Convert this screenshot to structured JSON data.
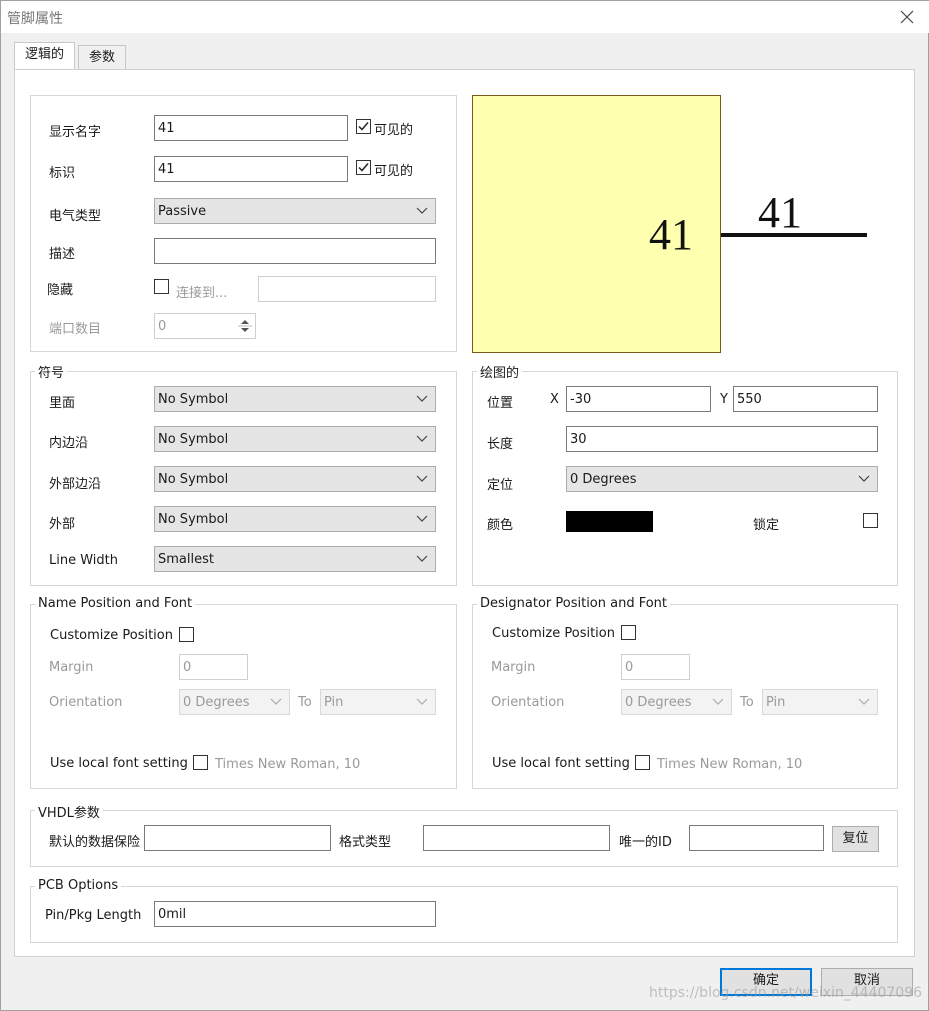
{
  "window": {
    "title": "管脚属性"
  },
  "tabs": [
    "逻辑的",
    "参数"
  ],
  "logical": {
    "display_name": {
      "label": "显示名字",
      "value": "41",
      "visible_label": "可见的",
      "visible_checked": true
    },
    "designator": {
      "label": "标识",
      "value": "41",
      "visible_label": "可见的",
      "visible_checked": true
    },
    "electrical_type": {
      "label": "电气类型",
      "value": "Passive"
    },
    "description": {
      "label": "描述",
      "value": ""
    },
    "hidden": {
      "label": "隐藏",
      "checked": false,
      "connect_label": "连接到...",
      "connect_value": ""
    },
    "port_count": {
      "label": "端口数目",
      "value": "0"
    }
  },
  "preview": {
    "name_text": "41",
    "designator_text": "41",
    "fill_color": "#ffffb0",
    "border_color": "#7a5a1a"
  },
  "symbols": {
    "title": "符号",
    "inside": {
      "label": "里面",
      "value": "No Symbol"
    },
    "inside_edge": {
      "label": "内边沿",
      "value": "No Symbol"
    },
    "outside_edge": {
      "label": "外部边沿",
      "value": "No Symbol"
    },
    "outside": {
      "label": "外部",
      "value": "No Symbol"
    },
    "line_width": {
      "label": "Line Width",
      "value": "Smallest"
    }
  },
  "graphical": {
    "title": "绘图的",
    "location": {
      "label": "位置",
      "x_label": "X",
      "x_value": "-30",
      "y_label": "Y",
      "y_value": "550"
    },
    "length": {
      "label": "长度",
      "value": "30"
    },
    "orientation": {
      "label": "定位",
      "value": "0 Degrees"
    },
    "color": {
      "label": "颜色",
      "value": "#000000"
    },
    "locked": {
      "label": "锁定",
      "checked": false
    }
  },
  "name_position": {
    "title": "Name Position and Font",
    "customize_label": "Customize Position",
    "margin_label": "Margin",
    "margin_value": "0",
    "orientation_label": "Orientation",
    "orientation_value": "0 Degrees",
    "to_label": "To",
    "to_value": "Pin",
    "font_label": "Use local font setting",
    "font_value": "Times New Roman, 10"
  },
  "designator_position": {
    "title": "Designator Position and Font",
    "customize_label": "Customize Position",
    "margin_label": "Margin",
    "margin_value": "0",
    "orientation_label": "Orientation",
    "orientation_value": "0 Degrees",
    "to_label": "To",
    "to_value": "Pin",
    "font_label": "Use local font setting",
    "font_value": "Times New Roman, 10"
  },
  "vhdl": {
    "title": "VHDL参数",
    "default_label": "默认的数据保险",
    "default_value": "",
    "format_label": "格式类型",
    "format_value": "",
    "uid_label": "唯一的ID",
    "uid_value": "",
    "reset_label": "复位"
  },
  "pcb": {
    "title": "PCB Options",
    "length_label": "Pin/Pkg Length",
    "length_value": "0mil"
  },
  "buttons": {
    "ok": "确定",
    "cancel": "取消"
  },
  "watermark": "https://blog.csdn.net/weixin_44407096"
}
